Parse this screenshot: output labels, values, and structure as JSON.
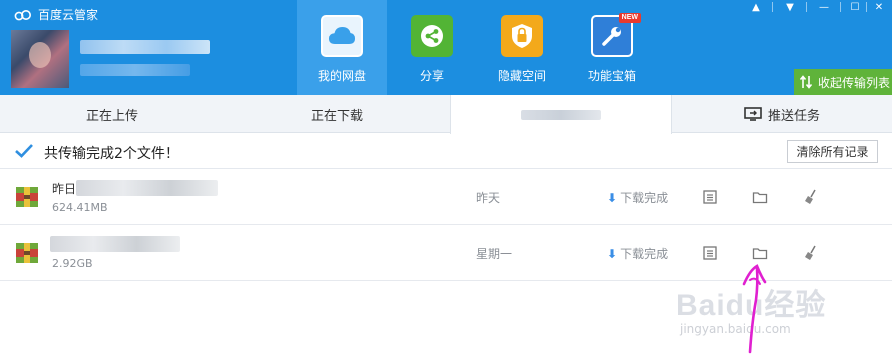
{
  "app": {
    "title": "百度云管家"
  },
  "window_controls": [
    "▲",
    "▼",
    "—",
    "☐",
    "✕"
  ],
  "nav": [
    {
      "label": "我的网盘",
      "icon": "cloud-icon",
      "active": true
    },
    {
      "label": "分享",
      "icon": "share-icon",
      "active": false
    },
    {
      "label": "隐藏空间",
      "icon": "lock-icon",
      "active": false
    },
    {
      "label": "功能宝箱",
      "icon": "wrench-icon",
      "active": false,
      "badge": "NEW"
    }
  ],
  "collapse_button": {
    "label": "收起传输列表"
  },
  "tabs": [
    {
      "label": "正在上传",
      "active": false
    },
    {
      "label": "正在下载",
      "active": false
    },
    {
      "label": "",
      "active": true
    },
    {
      "label": "推送任务",
      "active": false,
      "icon": "screen-push-icon"
    }
  ],
  "summary": {
    "text": "共传输完成2个文件！",
    "clear_button": "清除所有记录"
  },
  "files": [
    {
      "name_prefix": "昨日",
      "size": "624.41MB",
      "time": "昨天",
      "status": "下载完成"
    },
    {
      "name_prefix": "",
      "size": "2.92GB",
      "time": "星期一",
      "status": "下载完成"
    }
  ],
  "watermark": {
    "main": "Baidu经验",
    "sub": "jingyan.baidu.com"
  },
  "colors": {
    "header": "#1c8ee0",
    "nav_active": "#3aa0ea",
    "collapse_button": "#5fb33a",
    "annotation": "#e020d0"
  }
}
